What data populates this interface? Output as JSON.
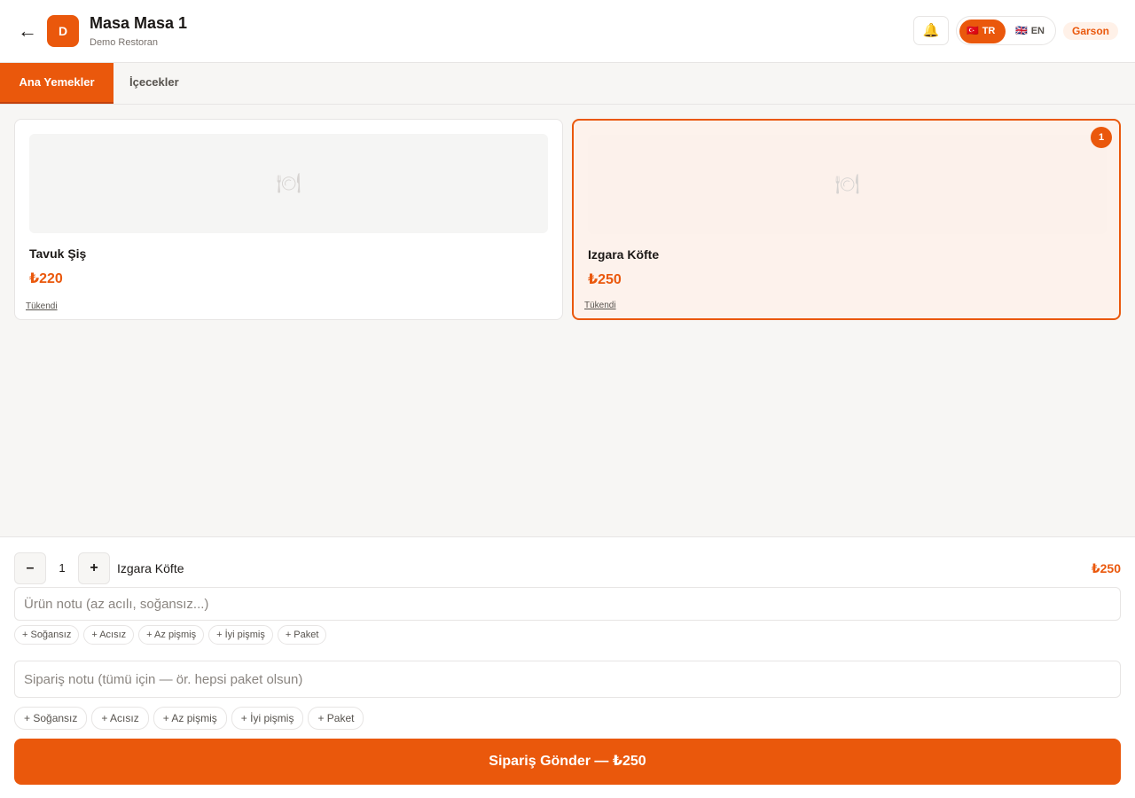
{
  "header": {
    "back_icon": "←",
    "logo_letter": "D",
    "title": "Masa Masa 1",
    "subtitle": "Demo Restoran",
    "bell_icon": "🔔",
    "languages": [
      {
        "flag": "🇹🇷",
        "code": "TR",
        "active": true
      },
      {
        "flag": "🇬🇧",
        "code": "EN",
        "active": false
      }
    ],
    "role": "Garson"
  },
  "tabs": [
    {
      "label": "Ana Yemekler",
      "active": true
    },
    {
      "label": "İçecekler",
      "active": false
    }
  ],
  "products": [
    {
      "name": "Tavuk Şiş",
      "price": "₺220",
      "status": "Tükendi",
      "image_icon": "🍽",
      "selected": false
    },
    {
      "name": "Izgara Köfte",
      "price": "₺250",
      "status": "Tükendi",
      "image_icon": "🍽",
      "selected": true,
      "badge_count": "1"
    }
  ],
  "order": {
    "line": {
      "minus_label": "–",
      "plus_label": "+",
      "quantity": "1",
      "name": "Izgara Köfte",
      "price": "₺250"
    },
    "item_note_placeholder": "Ürün notu (az acılı, soğansız...)",
    "item_chips": [
      "+ Soğansız",
      "+ Acısız",
      "+ Az pişmiş",
      "+ İyi pişmiş",
      "+ Paket"
    ],
    "order_note_placeholder": "Sipariş notu (tümü için — ör. hepsi paket olsun)",
    "order_chips": [
      "+ Soğansız",
      "+ Acısız",
      "+ Az pişmiş",
      "+ İyi pişmiş",
      "+ Paket"
    ],
    "submit_label": "Sipariş Gönder — ₺250"
  },
  "colors": {
    "accent": "#ea580c",
    "selected_card_bg": "#fdf2ec"
  }
}
